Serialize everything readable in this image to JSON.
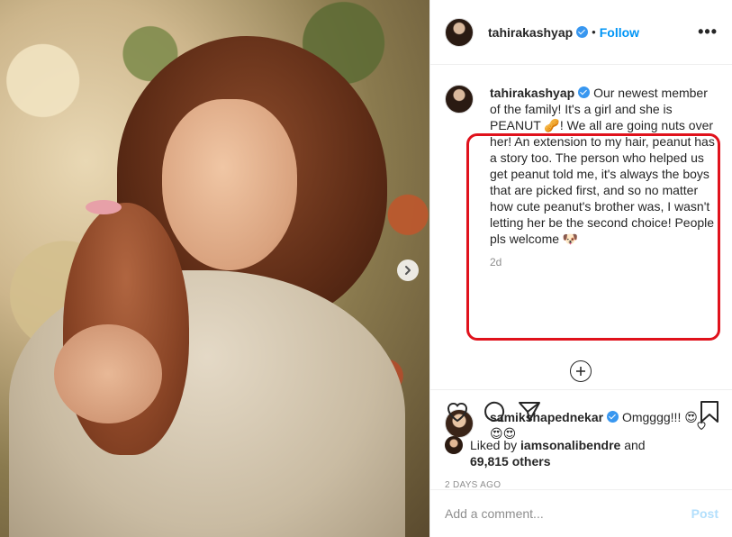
{
  "header": {
    "username": "tahirakashyap",
    "separator": "•",
    "follow_label": "Follow",
    "more_label": "•••"
  },
  "caption": {
    "username": "tahirakashyap",
    "text": "Our newest member of the family! It's a girl and she is PEANUT 🥜! We all are going nuts over her! An extension to my hair, peanut has a story too. The person who helped us get peanut told me, it's always the boys that are picked first, and so no matter how cute peanut's brother was, I wasn't letting her be the second choice! People pls welcome 🐶",
    "time": "2d"
  },
  "comment": {
    "username": "samikshapednekar",
    "text": "Omgggg!!! 😍😍😍"
  },
  "likes": {
    "prefix": "Liked by",
    "liker": "iamsonalibendre",
    "and": "and",
    "count": "69,815 others"
  },
  "timestamp": "2 DAYS AGO",
  "add_comment": {
    "placeholder": "Add a comment...",
    "post_label": "Post"
  },
  "icons": {
    "like": "heart-icon",
    "comment": "comment-icon",
    "share": "share-icon",
    "save": "bookmark-icon",
    "next": "chevron-right-icon",
    "load_more": "plus-circle-icon"
  },
  "colors": {
    "link": "#0095f6",
    "verified": "#3897f0",
    "highlight": "#e0121c",
    "muted": "#8e8e8e"
  }
}
